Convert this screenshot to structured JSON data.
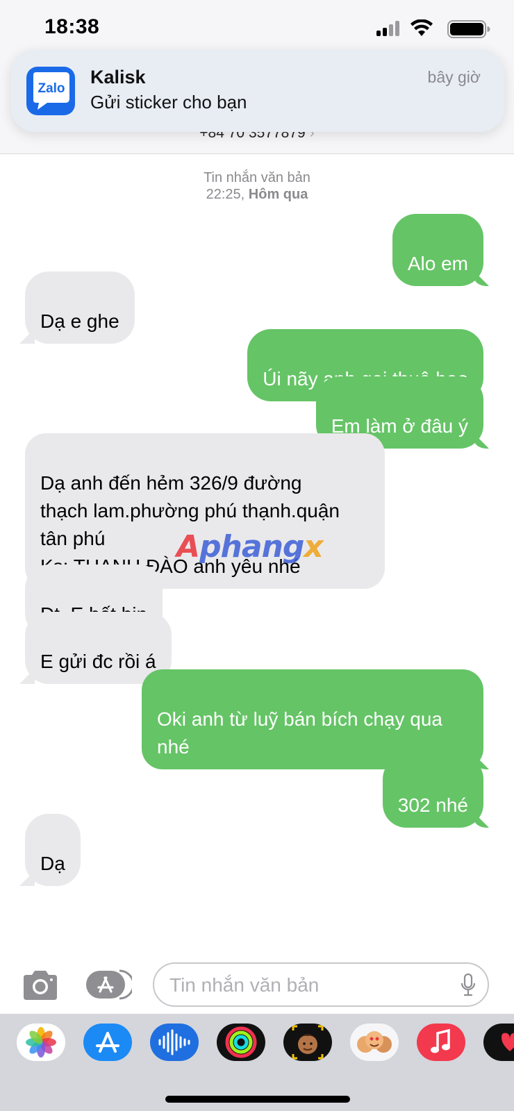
{
  "status_bar": {
    "time": "18:38"
  },
  "notification": {
    "app_icon_text": "Zalo",
    "title": "Kalisk",
    "body": "Gửi sticker cho bạn",
    "time": "bây giờ"
  },
  "header": {
    "contact_number": "+84 70 3577879",
    "chevron": "›"
  },
  "conversation": {
    "timestamp_label": "Tin nhắn văn bản",
    "timestamp_time": "22:25,",
    "timestamp_day": "Hôm qua",
    "messages": [
      {
        "text": "Alo em",
        "direction": "sent"
      },
      {
        "text": "Dạ e ghe",
        "direction": "received"
      },
      {
        "text": "Úi nãy anh gọi thuê bao",
        "direction": "sent"
      },
      {
        "text": "Em làm ở đâu ý",
        "direction": "sent"
      },
      {
        "text": "Dạ anh đến hẻm 326/9 đường\nthạch lam.phường phú thạnh.quận\ntân phú\nKs: THANH ĐÀO anh yêu nhé",
        "direction": "received"
      },
      {
        "text": "Đt. E hết bin",
        "direction": "received"
      },
      {
        "text": "E gửi đc rồi á",
        "direction": "received"
      },
      {
        "text": "Oki anh từ luỹ bán bích chạy qua\nnhé",
        "direction": "sent"
      },
      {
        "text": "302 nhé",
        "direction": "sent"
      },
      {
        "text": "Dạ",
        "direction": "received"
      }
    ]
  },
  "watermark": {
    "part1": "A",
    "part2": "phang",
    "part3": "x"
  },
  "composer": {
    "placeholder": "Tin nhắn văn bản"
  },
  "app_drawer": {
    "apps": [
      {
        "icon": "photos-icon"
      },
      {
        "icon": "app-store-icon"
      },
      {
        "icon": "audio-message-icon"
      },
      {
        "icon": "activity-icon"
      },
      {
        "icon": "memoji-icon"
      },
      {
        "icon": "memoji-stickers-icon"
      },
      {
        "icon": "music-icon"
      },
      {
        "icon": "heart-app-icon"
      }
    ]
  },
  "colors": {
    "sent_bubble": "#65c466",
    "received_bubble": "#e9e9eb",
    "zalo_blue": "#1a6ae8"
  }
}
